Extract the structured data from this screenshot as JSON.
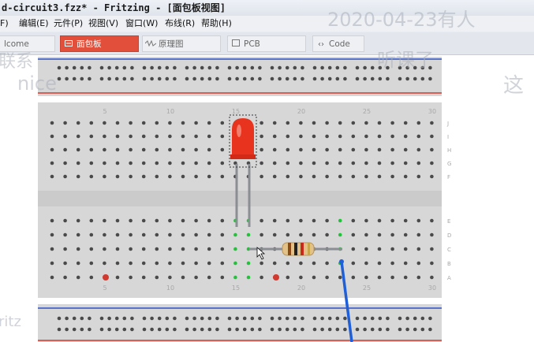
{
  "window": {
    "title": "d-circuit3.fzz* - Fritzing - [面包板视图]"
  },
  "menu": {
    "items": [
      "F)",
      "编辑(E)",
      "元件(P)",
      "视图(V)",
      "窗口(W)",
      "布线(R)",
      "帮助(H)"
    ]
  },
  "tabs": [
    {
      "label": "lcome",
      "icon": "none",
      "active": false
    },
    {
      "label": "面包板",
      "icon": "breadboard-icon",
      "active": true
    },
    {
      "label": "原理图",
      "icon": "schematic-wave-icon",
      "active": false
    },
    {
      "label": "PCB",
      "icon": "pcb-icon",
      "active": false
    },
    {
      "label": "Code",
      "icon": "code-brackets-icon",
      "active": false
    }
  ],
  "overlays": {
    "timestamp": "2020-04-23有人",
    "left_top": "联系",
    "left_mid": "nice",
    "right_top": "听课了",
    "right_mid": "这",
    "bottom_left": "ritz"
  },
  "breadboard": {
    "column_numbers": [
      "5",
      "10",
      "15",
      "20",
      "25",
      "30"
    ],
    "row_letters_top": [
      "J",
      "I",
      "H",
      "G",
      "F"
    ],
    "row_letters_bottom": [
      "E",
      "D",
      "C",
      "B",
      "A"
    ]
  },
  "colors": {
    "board": "#d7d7d7",
    "hole": "#4a4a4a",
    "rail_blue": "#2f53c5",
    "rail_red": "#d23a2f",
    "led": "#e8331e",
    "wire_blue": "#1f5fd8",
    "leg": "#8b8e93",
    "highlight_green": "#22c33a",
    "tab_active": "#e2503b"
  }
}
